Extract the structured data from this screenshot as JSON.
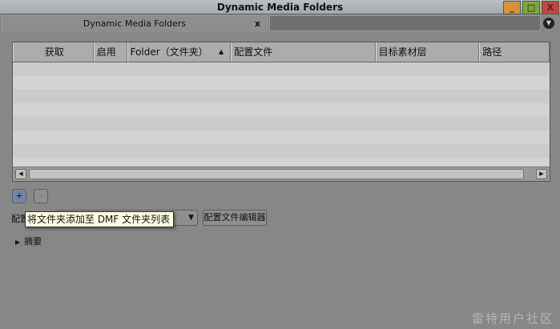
{
  "window": {
    "title": "Dynamic Media Folders",
    "minimize": "_",
    "maximize": "□",
    "close": "X"
  },
  "tab": {
    "label": "Dynamic Media Folders",
    "close": "x",
    "menu_icon": "▼"
  },
  "table": {
    "columns": [
      "获取",
      "启用",
      "Folder（文件夹）",
      "配置文件",
      "目标素材层",
      "路径"
    ],
    "sort_indicator": "▲",
    "rows": []
  },
  "scroll": {
    "left": "◀",
    "right": "▶"
  },
  "buttons": {
    "add": "+",
    "remove": "-",
    "profile_editor": "配置文件编辑器"
  },
  "profile": {
    "label": "配置文件",
    "selected": "",
    "dropdown_icon": "▼"
  },
  "tooltip": "将文件夹添加至 DMF 文件夹列表",
  "summary": {
    "label": "摘要",
    "icon": "▶"
  },
  "watermark": "雷特用户社区",
  "colors": {
    "background": "#878787",
    "add_button": "#6f86a8",
    "tooltip": "#ffffe1",
    "close": "#c8443f",
    "maximize": "#7ea638",
    "minimize": "#d5923a"
  }
}
